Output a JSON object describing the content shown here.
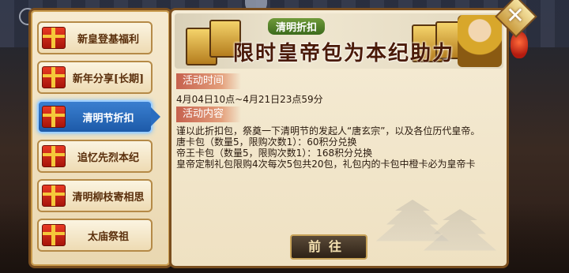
{
  "menu": {
    "items": [
      {
        "label": "新皇登基福利"
      },
      {
        "label": "新年分享[长期]"
      },
      {
        "label": "清明节折扣"
      },
      {
        "label": "追忆先烈本纪"
      },
      {
        "label": "清明柳枝寄相思"
      },
      {
        "label": "太庙祭祖"
      }
    ],
    "active_index": 2
  },
  "banner": {
    "subtitle": "清明折扣",
    "title": "限时皇帝包为本纪助力"
  },
  "activity_time": {
    "label": "活动时间",
    "value": "4月04日10点~4月21日23点59分"
  },
  "activity_content": {
    "label": "活动内容",
    "lines": [
      "谨以此折扣包，祭奠一下清明节的发起人“唐玄宗”，以及各位历代皇帝。",
      "唐卡包（数量5，限购次数1）：60积分兑换",
      "帝王卡包（数量5，限购次数1）：168积分兑换",
      "皇帝定制礼包限购4次每次5包共20包，礼包内的卡包中橙卡必为皇帝卡"
    ]
  },
  "go_button": {
    "label": "前往"
  },
  "close_button": {
    "glyph": "✕"
  },
  "icons": {
    "gift": "gift-box-icon",
    "close": "close-icon",
    "back": "back-icon"
  },
  "colors": {
    "active_tab": "#1d5aa8",
    "panel_border": "#7a4e1e",
    "section_tag": "#c6614e"
  }
}
